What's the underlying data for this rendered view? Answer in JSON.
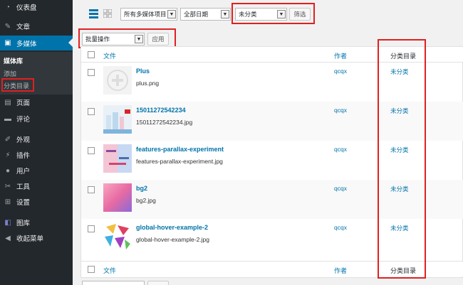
{
  "sidebar": {
    "items": [
      {
        "label": "仪表盘",
        "icon": "dashboard-icon"
      },
      {
        "label": "文章",
        "icon": "pin-icon"
      },
      {
        "label": "多媒体",
        "icon": "media-icon"
      },
      {
        "label": "页面",
        "icon": "page-icon"
      },
      {
        "label": "评论",
        "icon": "comment-icon"
      },
      {
        "label": "外观",
        "icon": "brush-icon"
      },
      {
        "label": "插件",
        "icon": "plugin-icon"
      },
      {
        "label": "用户",
        "icon": "user-icon"
      },
      {
        "label": "工具",
        "icon": "wrench-icon"
      },
      {
        "label": "设置",
        "icon": "settings-icon"
      },
      {
        "label": "图库",
        "icon": "gallery-icon"
      },
      {
        "label": "收起菜单",
        "icon": "collapse-icon"
      }
    ],
    "submenu": [
      "媒体库",
      "添加",
      "分类目录"
    ]
  },
  "filters": {
    "media_type": "所有多媒体项目",
    "date": "全部日期",
    "category": "未分类",
    "filter_button": "筛选"
  },
  "bulk": {
    "select": "批量操作",
    "apply_button": "应用"
  },
  "table": {
    "headers": {
      "file": "文件",
      "author": "作者",
      "category": "分类目录"
    },
    "rows": [
      {
        "title": "Plus",
        "filename": "plus.png",
        "author": "qcqx",
        "category": "未分类"
      },
      {
        "title": "15011272542234",
        "filename": "15011272542234.jpg",
        "author": "qcqx",
        "category": "未分类"
      },
      {
        "title": "features-parallax-experiment",
        "filename": "features-parallax-experiment.jpg",
        "author": "qcqx",
        "category": "未分类"
      },
      {
        "title": "bg2",
        "filename": "bg2.jpg",
        "author": "qcqx",
        "category": "未分类"
      },
      {
        "title": "global-hover-example-2",
        "filename": "global-hover-example-2.jpg",
        "author": "qcqx",
        "category": "未分类"
      }
    ]
  },
  "colors": {
    "accent": "#0073aa",
    "sidebar": "#23282d",
    "highlight": "#e02020"
  }
}
